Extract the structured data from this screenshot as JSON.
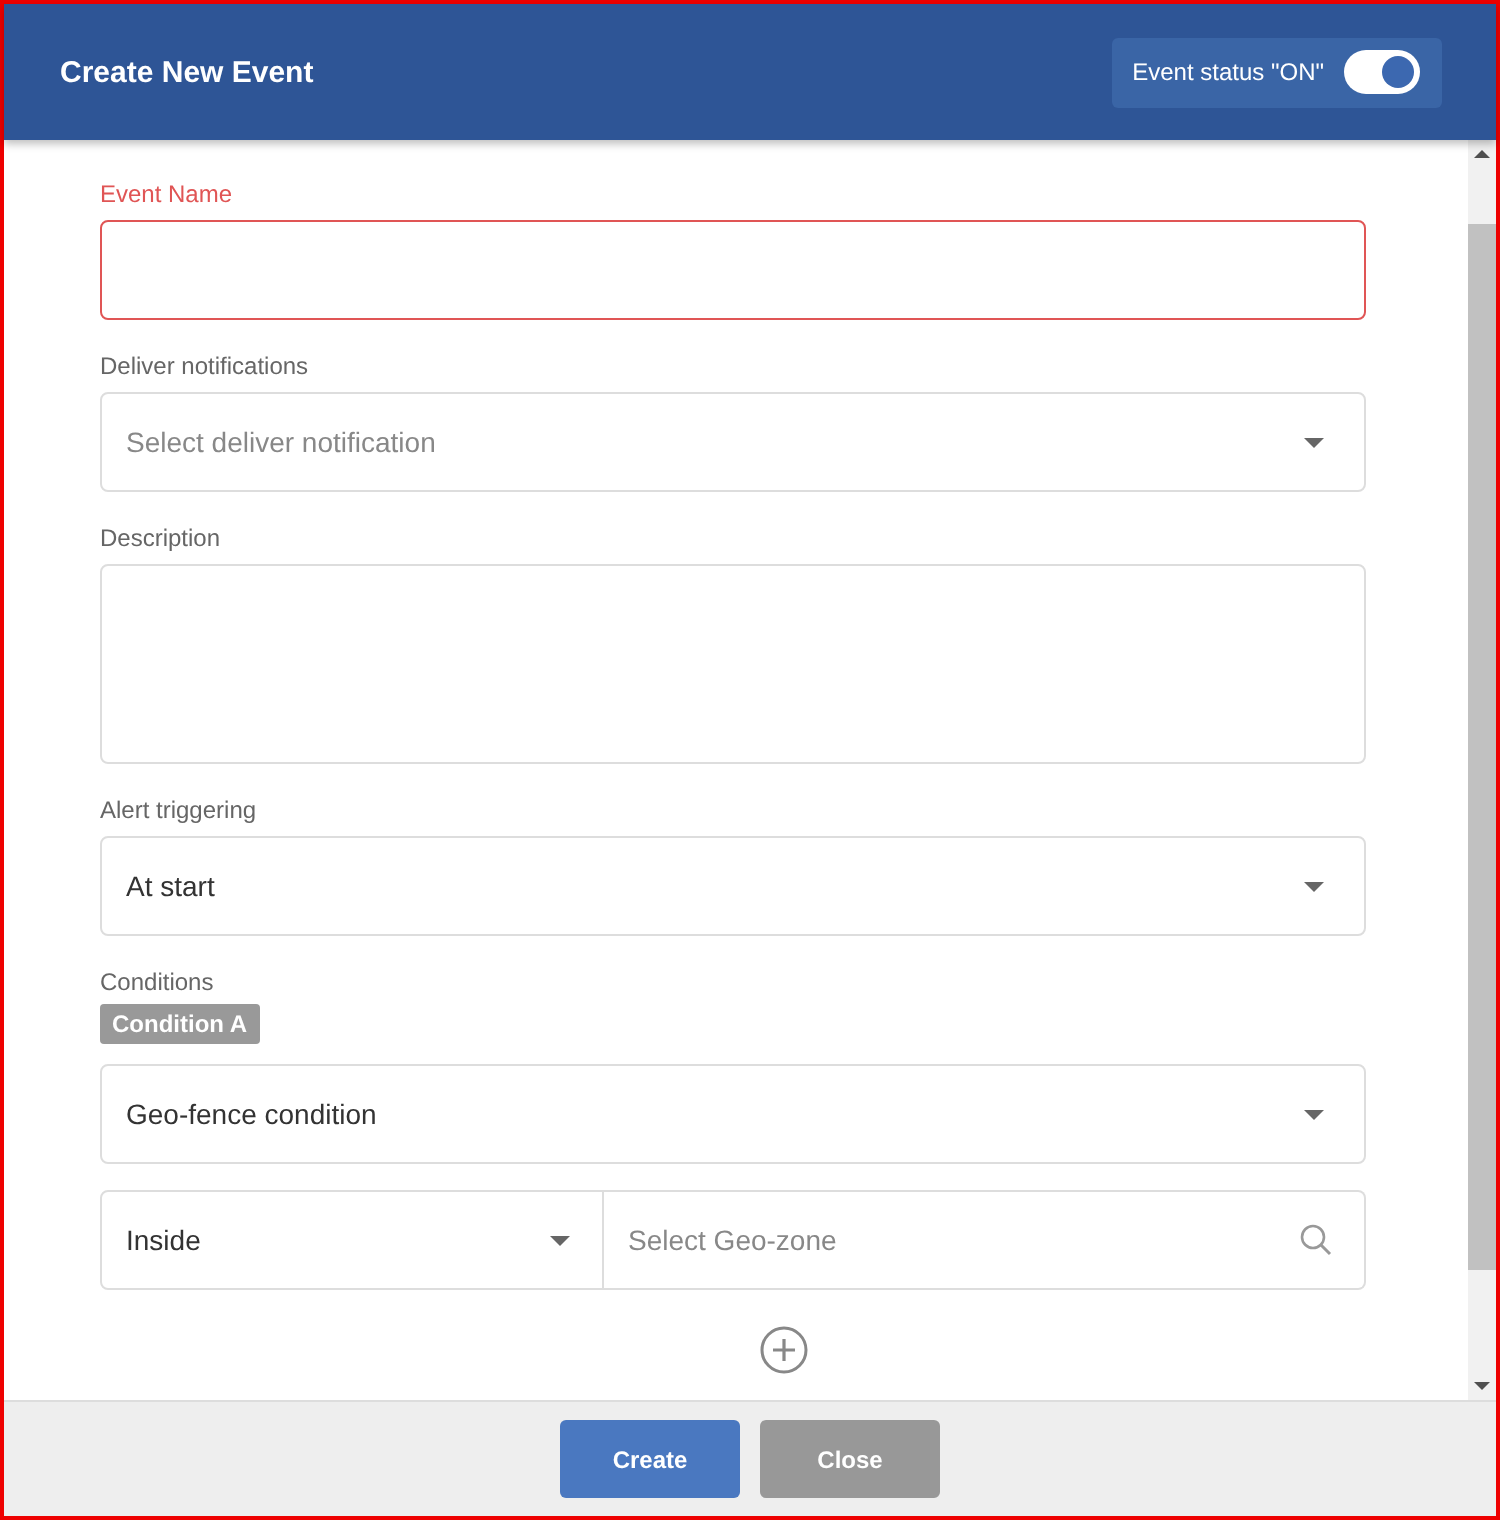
{
  "header": {
    "title": "Create New Event",
    "status_label": "Event status \"ON\"",
    "status_on": true
  },
  "fields": [
    {
      "kind": "text",
      "label": "Event Name",
      "error": true
    },
    {
      "kind": "select",
      "label": "Deliver notifications",
      "placeholder": "Select deliver notification",
      "error": false
    },
    {
      "kind": "textarea",
      "label": "Description",
      "error": false
    },
    {
      "kind": "select",
      "label": "Alert triggering",
      "value": "At start",
      "error": false
    }
  ],
  "conditions": {
    "label": "Conditions",
    "badge": "Condition A",
    "type": "Geo-fence condition",
    "relation": "Inside",
    "zone_placeholder": "Select Geo-zone"
  },
  "buttons": [
    {
      "label": "Create",
      "kind": "primary"
    },
    {
      "label": "Close",
      "kind": "secondary"
    }
  ]
}
